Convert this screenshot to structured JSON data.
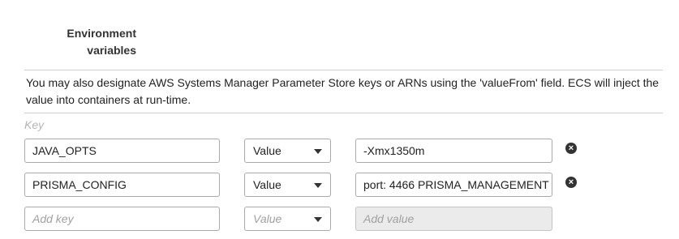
{
  "section": {
    "label_line1": "Environment",
    "label_line2": "variables"
  },
  "info_text": "You may also designate AWS Systems Manager Parameter Store keys or ARNs using the 'valueFrom' field. ECS will inject the value into containers at run-time.",
  "columns": {
    "key_header": "Key"
  },
  "rows": [
    {
      "key": "JAVA_OPTS",
      "type": "Value",
      "value": "-Xmx1350m"
    },
    {
      "key": "PRISMA_CONFIG",
      "type": "Value",
      "value": "port: 4466 PRISMA_MANAGEMENT"
    }
  ],
  "new_row": {
    "key_placeholder": "Add key",
    "type_placeholder": "Value",
    "value_placeholder": "Add value"
  },
  "icons": {
    "remove": "remove-circle-icon",
    "dropdown": "caret-down-icon"
  }
}
